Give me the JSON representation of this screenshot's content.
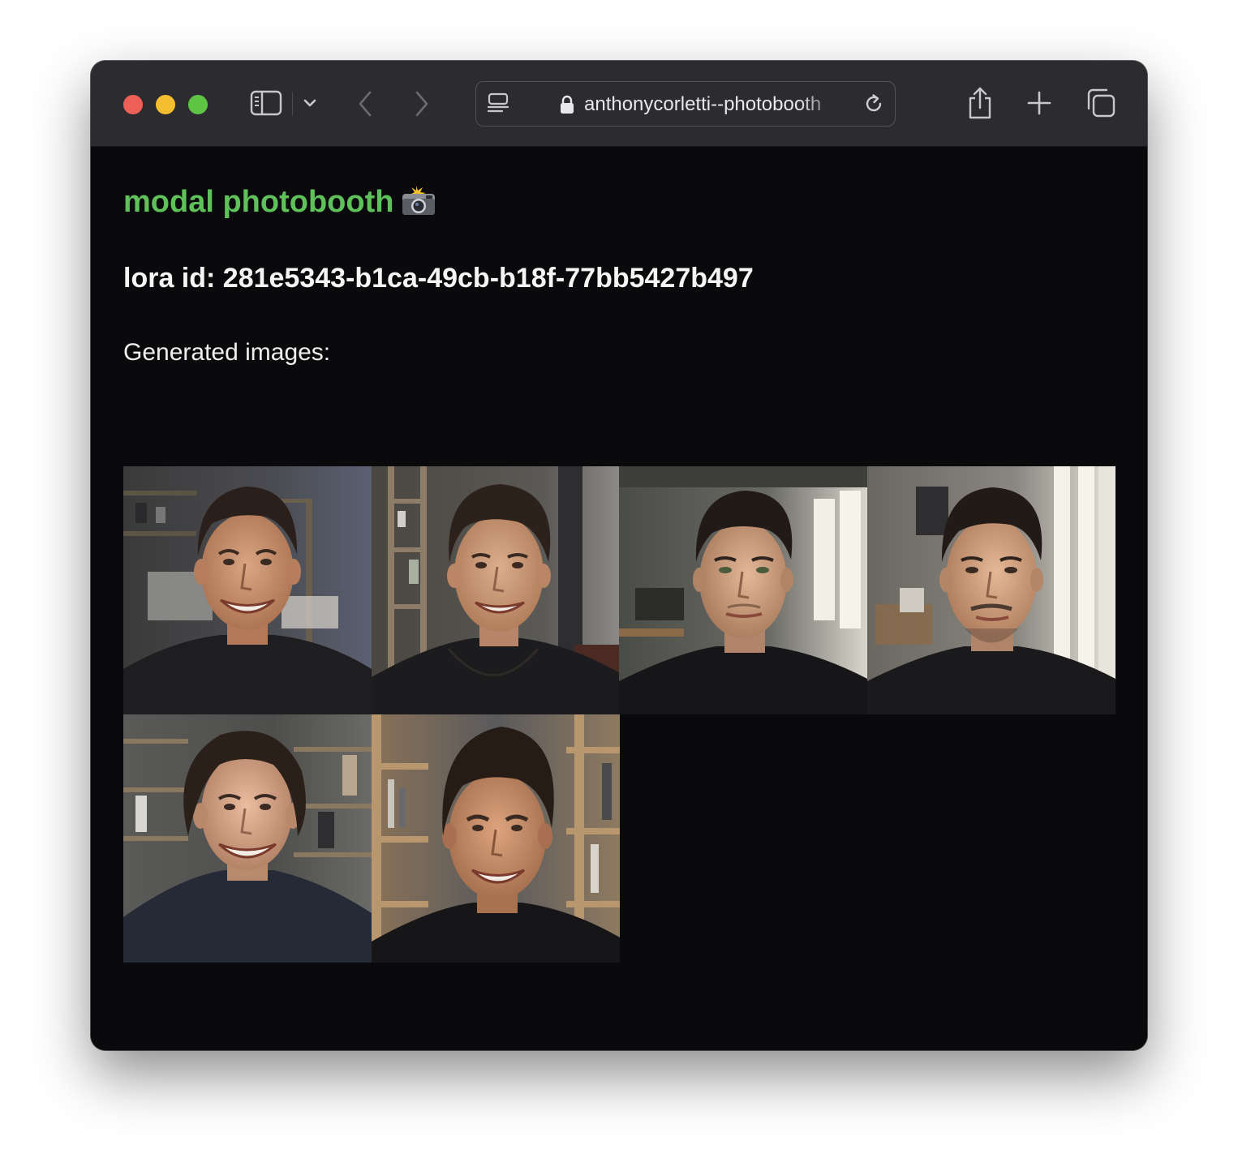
{
  "browser": {
    "url": "anthonycorletti--photobooth",
    "icons": {
      "sidebar": "sidebar-icon",
      "chevron": "chevron-down-icon",
      "back": "chevron-left-icon",
      "forward": "chevron-right-icon",
      "reader": "reader-icon",
      "lock": "lock-icon",
      "reload": "reload-icon",
      "share": "share-icon",
      "new_tab": "plus-icon",
      "tabs_overview": "tabs-overview-icon"
    }
  },
  "page": {
    "title": "modal photobooth",
    "title_emoji": "camera-flash-emoji",
    "title_color": "#5fc15a",
    "lora_line": "lora id: 281e5343-b1ca-49cb-b18f-77bb5427b497",
    "generated_label": "Generated images:",
    "images": [
      {
        "name": "generated-image-1"
      },
      {
        "name": "generated-image-2"
      },
      {
        "name": "generated-image-3"
      },
      {
        "name": "generated-image-4"
      },
      {
        "name": "generated-image-5"
      },
      {
        "name": "generated-image-6"
      }
    ]
  },
  "colors": {
    "page_background": "#0a0a0c",
    "toolbar_background": "#2c2c30",
    "text": "#f5f5f5"
  }
}
